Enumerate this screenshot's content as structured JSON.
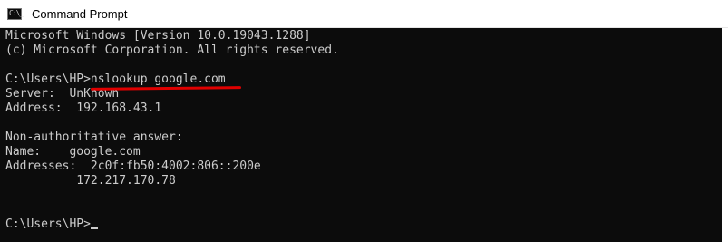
{
  "window": {
    "title": "Command Prompt",
    "icon": "cmd-app-icon",
    "icon_glyph": "C:\\_"
  },
  "console": {
    "version_line": "Microsoft Windows [Version 10.0.19043.1288]",
    "copyright_line": "(c) Microsoft Corporation. All rights reserved.",
    "command_line": "C:\\Users\\HP>nslookup google.com",
    "server_line": "Server:  UnKnown",
    "address_line": "Address:  192.168.43.1",
    "answer_header": "Non-authoritative answer:",
    "name_line": "Name:    google.com",
    "addresses_line": "Addresses:  2c0f:fb50:4002:806::200e",
    "addresses_line2": "          172.217.170.78",
    "prompt_line": "C:\\Users\\HP>"
  },
  "colors": {
    "console_background": "#0c0c0c",
    "console_text": "#cccccc",
    "annotation_underline": "#e00000"
  }
}
